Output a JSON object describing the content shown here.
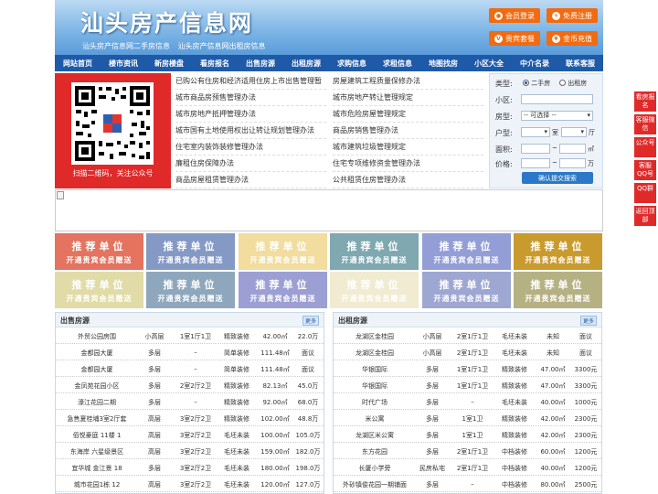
{
  "header": {
    "title": "汕头房产信息网",
    "subtitle": "汕头房产信息网二手房信息  汕头房产信息网出租房信息",
    "buttons": [
      "会员登录",
      "免费注册",
      "贵宾套餐",
      "金币充值"
    ]
  },
  "nav": [
    "网站首页",
    "楼市资讯",
    "新房楼盘",
    "看房报名",
    "出售房源",
    "出租房源",
    "求购信息",
    "求租信息",
    "地图找房",
    "小区大全",
    "中介名录",
    "联系客服"
  ],
  "qr": {
    "caption": "扫描二维码，关注公众号"
  },
  "links": {
    "left": [
      "已购公有住房和经济适用住房上市出售管理暂",
      "城市商品房预售管理办法",
      "城市房地产抵押管理办法",
      "城市国有土地使用权出让转让规划管理办法",
      "住宅室内装饰装修管理办法",
      "廉租住房保障办法",
      "商品房屋租赁管理办法"
    ],
    "right": [
      "房屋建筑工程质量保修办法",
      "城市房地产转让管理规定",
      "城市危险房屋管理规定",
      "商品房销售管理办法",
      "城市建筑垃圾管理规定",
      "住宅专项维修资金管理办法",
      "公共租赁住房管理办法"
    ]
  },
  "search": {
    "type_label": "类型:",
    "type_options": [
      "二手房",
      "出租房"
    ],
    "community_label": "小区:",
    "house_label": "房型:",
    "house_select": "-- 可选择 --",
    "layout_label": "户型:",
    "room_unit": "室",
    "hall_unit": "厅",
    "area_label": "面积:",
    "area_unit": "㎡",
    "range_sep": "~",
    "price_label": "价格:",
    "price_unit": "万",
    "submit": "确认提交搜索"
  },
  "colors": {
    "nav_bg": "#1e5aa8",
    "orange": "#f26b10",
    "qr_red": "#e02a2a",
    "tiles": [
      "#e4735f",
      "#8499c4",
      "#f2dc9e",
      "#7fa8b0",
      "#939ed6",
      "#c99a2e",
      "#e1dca7",
      "#8ea7bd",
      "#9c9fd4",
      "#f1ecd1",
      "#9ea7d2",
      "#b6b183"
    ]
  },
  "tile": {
    "line1": "推荐单位",
    "line2": "开通贵宾会员赠送"
  },
  "sale": {
    "title": "出售房源",
    "more": "更多",
    "rows": [
      [
        "外贸公园房围",
        "小高层",
        "1室1厅1卫",
        "精致装修",
        "42.00㎡",
        "22.0万"
      ],
      [
        "金都园大厦",
        "多层",
        "–",
        "简单装修",
        "111.48㎡",
        "面议"
      ],
      [
        "金都园大厦",
        "多层",
        "–",
        "简单装修",
        "111.48㎡",
        "面议"
      ],
      [
        "金凤苑花园小区",
        "多层",
        "2室2厅2卫",
        "精致装修",
        "82.13㎡",
        "45.0万"
      ],
      [
        "濠江花园二期",
        "多层",
        "–",
        "精致装修",
        "92.00㎡",
        "68.0万"
      ],
      [
        "急售夏桂埔3室2厅套",
        "高层",
        "3室2厅2卫",
        "精致装修",
        "102.00㎡",
        "48.8万"
      ],
      [
        "佰悦豪庭 11楼 1",
        "高层",
        "3室2厅2卫",
        "毛坯未装",
        "100.00㎡",
        "105.0万"
      ],
      [
        "东海岸 六星级景区",
        "高层",
        "3室2厅2卫",
        "毛坯未装",
        "159.00㎡",
        "182.0万"
      ],
      [
        "宜华城 金江景 18",
        "多层",
        "3室2厅2卫",
        "毛坯未装",
        "180.00㎡",
        "198.0万"
      ],
      [
        "城市花园1栋 12",
        "高层",
        "3室2厅2卫",
        "毛坯未装",
        "120.00㎡",
        "127.0万"
      ]
    ]
  },
  "rent": {
    "title": "出租房源",
    "more": "更多",
    "rows": [
      [
        "龙湖区金桂园",
        "小高层",
        "2室1厅1卫",
        "毛坯未装",
        "未知",
        "面议"
      ],
      [
        "龙湖区金桂园",
        "小高层",
        "2室1厅1卫",
        "毛坯未装",
        "未知",
        "面议"
      ],
      [
        "华银国际",
        "多层",
        "1室1厅1卫",
        "精致装修",
        "47.00㎡",
        "3300元"
      ],
      [
        "华银国际",
        "多层",
        "1室1厅1卫",
        "精致装修",
        "47.00㎡",
        "3300元"
      ],
      [
        "时代广场",
        "多层",
        "–",
        "毛坯未装",
        "40.00㎡",
        "1000元"
      ],
      [
        "米公寓",
        "多层",
        "1室1卫",
        "精致装修",
        "42.00㎡",
        "2300元"
      ],
      [
        "龙湖区米公寓",
        "多层",
        "1室1卫",
        "精致装修",
        "42.00㎡",
        "2300元"
      ],
      [
        "东方花园",
        "多层",
        "2室1厅1卫",
        "中档装修",
        "60.00㎡",
        "1200元"
      ],
      [
        "长厦小学旁",
        "民房私宅",
        "2室1厅1卫",
        "中档装修",
        "40.00㎡",
        "1200元"
      ],
      [
        "外砂镇俊花园一期铺面",
        "多层",
        "–",
        "中档装修",
        "80.00㎡",
        "2500元"
      ]
    ]
  },
  "side": [
    "看房报名",
    "客服微信",
    "公众号",
    "客服QQ号",
    "QQ群",
    "返回顶部"
  ]
}
